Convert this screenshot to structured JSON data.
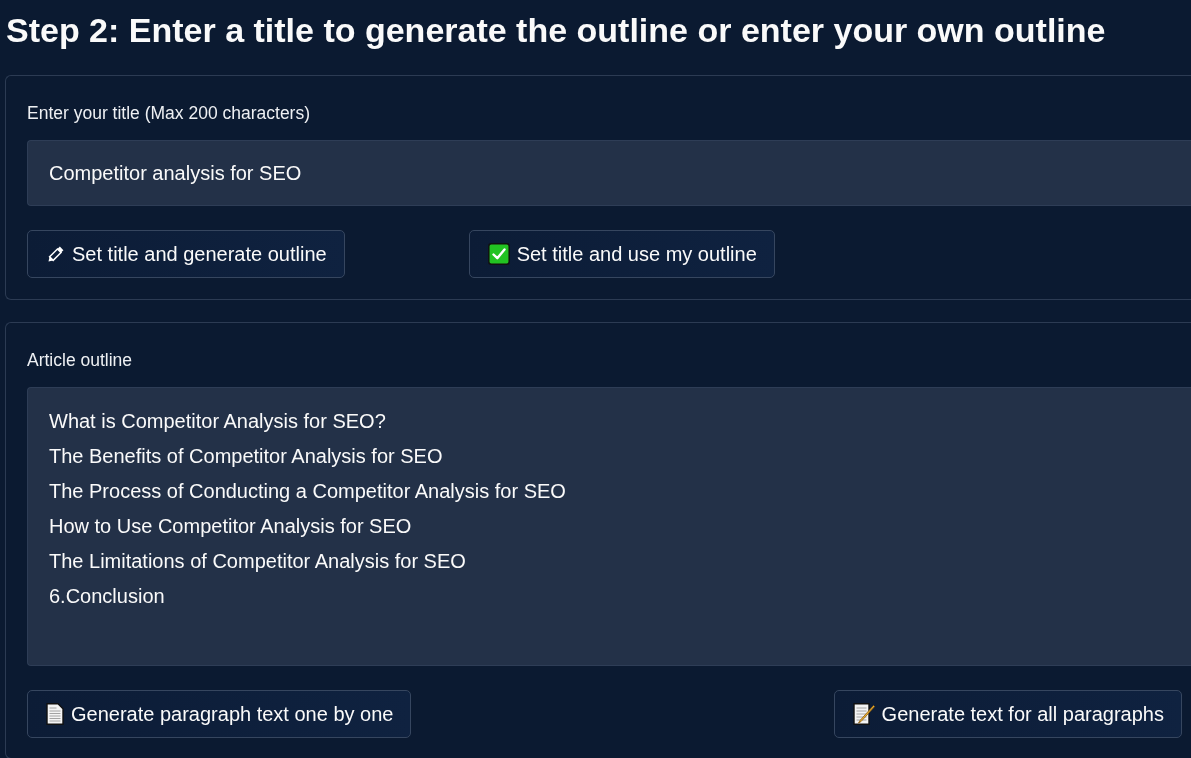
{
  "heading": "Step 2: Enter a title to generate the outline or enter your own outline",
  "title_section": {
    "label": "Enter your title (Max 200 characters)",
    "input": {
      "value": "Competitor analysis for SEO"
    },
    "buttons": [
      {
        "label": "Set title and generate outline"
      },
      {
        "label": "Set title and use my outline"
      }
    ]
  },
  "outline_section": {
    "label": "Article outline",
    "field": {
      "lines": [
        "What is Competitor Analysis for SEO?",
        "The Benefits of Competitor Analysis for SEO",
        "The Process of Conducting a Competitor Analysis for SEO",
        "How to Use Competitor Analysis for SEO",
        "The Limitations of Competitor Analysis for SEO",
        "6.Conclusion"
      ]
    },
    "buttons": [
      {
        "label": "Generate paragraph text one by one"
      },
      {
        "label": "Generate text for all paragraphs"
      }
    ]
  }
}
